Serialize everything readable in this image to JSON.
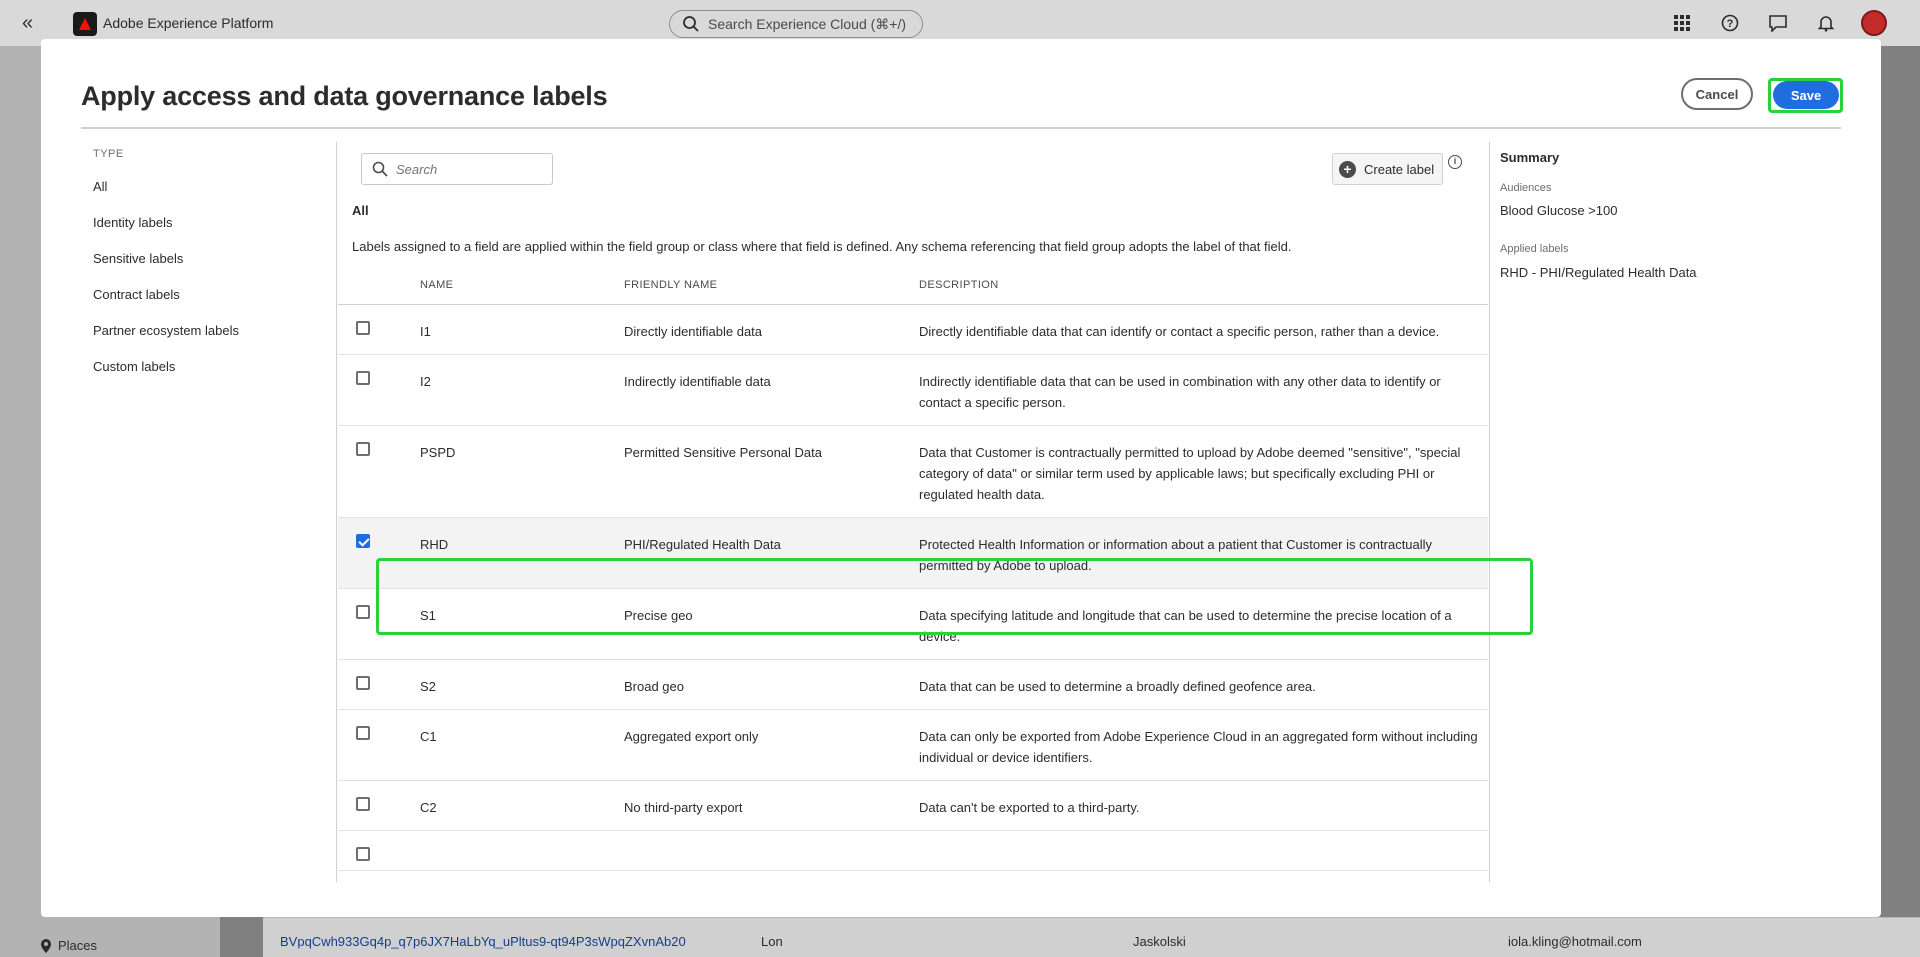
{
  "app": {
    "brand_name": "Adobe Experience Platform",
    "global_search_placeholder": "Search Experience Cloud (⌘+/)"
  },
  "background": {
    "row": {
      "id": "BVpqCwh933Gq4p_q7p6JX7HaLbYq_uPltus9-qt94P3sWpqZXvnAb20",
      "first_name": "Lon",
      "last_name": "Jaskolski",
      "email": "iola.kling@hotmail.com"
    },
    "sidebar_places": "Places"
  },
  "dialog": {
    "title": "Apply access and data governance labels",
    "cancel_label": "Cancel",
    "save_label": "Save"
  },
  "type_nav": {
    "heading": "TYPE",
    "items": [
      "All",
      "Identity labels",
      "Sensitive labels",
      "Contract labels",
      "Partner ecosystem labels",
      "Custom labels"
    ]
  },
  "center": {
    "search_placeholder": "Search",
    "create_label": "Create label",
    "section_title": "All",
    "note": "Labels assigned to a field are applied within the field group or class where that field is defined. Any schema referencing that field group adopts the label of that field.",
    "columns": {
      "name": "NAME",
      "friendly": "FRIENDLY NAME",
      "description": "DESCRIPTION"
    },
    "rows": [
      {
        "name": "I1",
        "friendly": "Directly identifiable data",
        "description": "Directly identifiable data that can identify or contact a specific person, rather than a device.",
        "checked": false
      },
      {
        "name": "I2",
        "friendly": "Indirectly identifiable data",
        "description": "Indirectly identifiable data that can be used in combination with any other data to identify or contact a specific person.",
        "checked": false
      },
      {
        "name": "PSPD",
        "friendly": "Permitted Sensitive Personal Data",
        "description": "Data that Customer is contractually permitted to upload by Adobe deemed \"sensitive\", \"special category of data\" or similar term used by applicable laws; but specifically excluding PHI or regulated health data.",
        "checked": false
      },
      {
        "name": "RHD",
        "friendly": "PHI/Regulated Health Data",
        "description": "Protected Health Information or information about a patient that Customer is contractually permitted by Adobe to upload.",
        "checked": true
      },
      {
        "name": "S1",
        "friendly": "Precise geo",
        "description": "Data specifying latitude and longitude that can be used to determine the precise location of a device.",
        "checked": false
      },
      {
        "name": "S2",
        "friendly": "Broad geo",
        "description": "Data that can be used to determine a broadly defined geofence area.",
        "checked": false
      },
      {
        "name": "C1",
        "friendly": "Aggregated export only",
        "description": "Data can only be exported from Adobe Experience Cloud in an aggregated form without including individual or device identifiers.",
        "checked": false
      },
      {
        "name": "C2",
        "friendly": "No third-party export",
        "description": "Data can't be exported to a third-party.",
        "checked": false
      }
    ]
  },
  "summary": {
    "title": "Summary",
    "audiences_label": "Audiences",
    "audiences_value": "Blood Glucose >100",
    "applied_label": "Applied labels",
    "applied_value": "RHD - PHI/Regulated Health Data"
  },
  "colors": {
    "accent": "#1f6ee0",
    "highlight": "#28d23c"
  }
}
